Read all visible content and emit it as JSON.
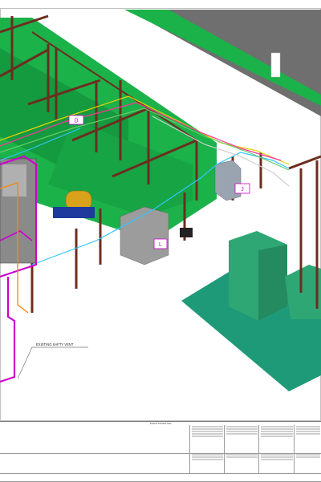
{
  "drawing": {
    "annotation": "EXISTING SAFTY VENT",
    "tags": {
      "tag_d": "D",
      "tag_j": "J",
      "tag_l": "L"
    }
  },
  "colors": {
    "floor_green": "#1bb24a",
    "equipment_green": "#2ea774",
    "teal_pad": "#1f9a78",
    "wall_gray": "#6f6f6f",
    "steel_brown": "#6b2e1f",
    "pipe_magenta": "#cc00cc",
    "pipe_cyan": "#2ec7ff",
    "tank_gold": "#d9a21a",
    "blue_base": "#1e3a9e"
  },
  "title_block": {
    "company": "PLANT PIPING ISO"
  }
}
